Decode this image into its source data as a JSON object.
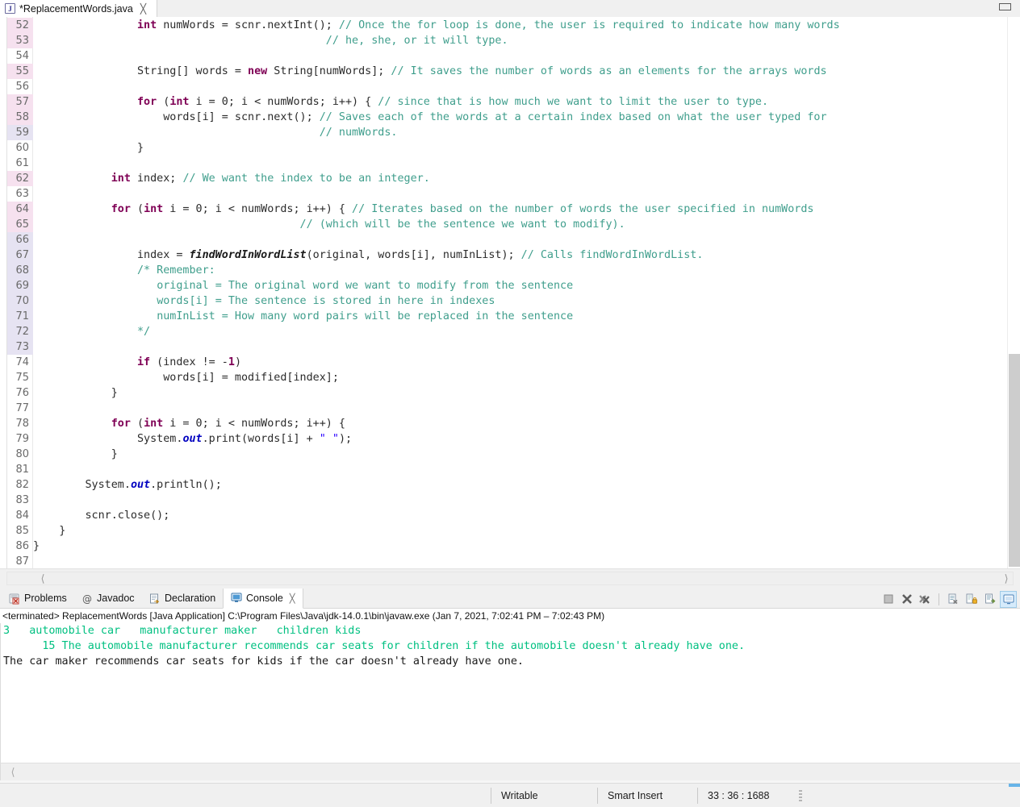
{
  "window": {
    "restore_button": "restore"
  },
  "editor_tab": {
    "filename": "*ReplacementWords.java",
    "icon": "java-file-icon",
    "close": "╳"
  },
  "editor": {
    "first_line": 52,
    "changed_lines_pink": [
      52,
      53,
      55,
      57,
      58,
      62,
      64,
      65
    ],
    "changed_lines_lavender": [
      59,
      66,
      67,
      68,
      69,
      70,
      71,
      72,
      73
    ],
    "lines": [
      {
        "n": 52,
        "indent": 0,
        "html": "                <kw>int</kw> numWords = scnr.nextInt(); <cm>// Once the for loop is done, the user is required to indicate how many words</cm>"
      },
      {
        "n": 53,
        "indent": 0,
        "html": "                                             <cm>// he, she, or it will type.</cm>"
      },
      {
        "n": 54,
        "indent": 0,
        "html": ""
      },
      {
        "n": 55,
        "indent": 0,
        "html": "                String[] words = <kw>new</kw> String[numWords]; <cm>// It saves the number of words as an elements for the arrays words</cm>"
      },
      {
        "n": 56,
        "indent": 0,
        "html": ""
      },
      {
        "n": 57,
        "indent": 0,
        "html": "                <kw>for</kw> (<kw>int</kw> i = 0; i &lt; numWords; i++) { <cm>// since that is how much we want to limit the user to type.</cm>"
      },
      {
        "n": 58,
        "indent": 0,
        "html": "                    words[i] = scnr.next(); <cm>// Saves each of the words at a certain index based on what the user typed for</cm>"
      },
      {
        "n": 59,
        "indent": 0,
        "html": "                                            <cm>// numWords.</cm>"
      },
      {
        "n": 60,
        "indent": 0,
        "html": "                }"
      },
      {
        "n": 61,
        "indent": 0,
        "html": ""
      },
      {
        "n": 62,
        "indent": 0,
        "html": "            <kw>int</kw> index; <cm>// We want the index to be an integer.</cm>"
      },
      {
        "n": 63,
        "indent": 0,
        "html": ""
      },
      {
        "n": 64,
        "indent": 0,
        "html": "            <kw>for</kw> (<kw>int</kw> i = 0; i &lt; numWords; i++) { <cm>// Iterates based on the number of words the user specified in numWords</cm>"
      },
      {
        "n": 65,
        "indent": 0,
        "html": "                                         <cm>// (which will be the sentence we want to modify).</cm>"
      },
      {
        "n": 66,
        "indent": 0,
        "html": ""
      },
      {
        "n": 67,
        "indent": 0,
        "html": "                index = <mth>findWordInWordList</mth>(original, words[i], numInList); <cm>// Calls findWordInWordList.</cm>"
      },
      {
        "n": 68,
        "indent": 0,
        "html": "                <cm>/* Remember:</cm>"
      },
      {
        "n": 69,
        "indent": 0,
        "html": "                   <cm>original = The original word we want to modify from the sentence</cm>"
      },
      {
        "n": 70,
        "indent": 0,
        "html": "                   <cm>words[i] = The sentence is stored in here in indexes</cm>"
      },
      {
        "n": 71,
        "indent": 0,
        "html": "                   <cm>numInList = How many word pairs will be replaced in the sentence</cm>"
      },
      {
        "n": 72,
        "indent": 0,
        "html": "                <cm>*/</cm>"
      },
      {
        "n": 73,
        "indent": 0,
        "html": ""
      },
      {
        "n": 74,
        "indent": 0,
        "html": "                <kw>if</kw> (index != -<kw>1</kw>)"
      },
      {
        "n": 75,
        "indent": 0,
        "html": "                    words[i] = modified[index];"
      },
      {
        "n": 76,
        "indent": 0,
        "html": "            }"
      },
      {
        "n": 77,
        "indent": 0,
        "html": ""
      },
      {
        "n": 78,
        "indent": 0,
        "html": "            <kw>for</kw> (<kw>int</kw> i = 0; i &lt; numWords; i++) {"
      },
      {
        "n": 79,
        "indent": 0,
        "html": "                System.<fld>out</fld>.print(words[i] + <str>\" \"</str>);"
      },
      {
        "n": 80,
        "indent": 0,
        "html": "            }"
      },
      {
        "n": 81,
        "indent": 0,
        "html": ""
      },
      {
        "n": 82,
        "indent": 0,
        "html": "        System.<fld>out</fld>.println();"
      },
      {
        "n": 83,
        "indent": 0,
        "html": ""
      },
      {
        "n": 84,
        "indent": 0,
        "html": "        scnr.close();"
      },
      {
        "n": 85,
        "indent": 0,
        "html": "    }"
      },
      {
        "n": 86,
        "indent": 0,
        "html": "}"
      },
      {
        "n": 87,
        "indent": 0,
        "html": ""
      }
    ]
  },
  "panel": {
    "tabs": [
      {
        "label": "Problems",
        "icon": "problems-icon",
        "active": false,
        "closable": false
      },
      {
        "label": "Javadoc",
        "icon": "javadoc-icon",
        "active": false,
        "closable": false
      },
      {
        "label": "Declaration",
        "icon": "declaration-icon",
        "active": false,
        "closable": false
      },
      {
        "label": "Console",
        "icon": "console-icon",
        "active": true,
        "closable": true
      }
    ],
    "close_glyph": "╳",
    "toolbar": [
      {
        "name": "terminate-button",
        "icon": "stop-square-icon"
      },
      {
        "name": "remove-launch-button",
        "icon": "x-icon"
      },
      {
        "name": "remove-all-terminated-button",
        "icon": "xx-icon"
      },
      {
        "name": "clear-console-button",
        "icon": "clear-page-icon"
      },
      {
        "name": "scroll-lock-button",
        "icon": "lock-icon"
      },
      {
        "name": "pin-console-button",
        "icon": "pin-page-icon"
      },
      {
        "name": "display-selected-console-button",
        "icon": "display-console-icon"
      }
    ],
    "launch_line": "<terminated> ReplacementWords [Java Application] C:\\Program Files\\Java\\jdk-14.0.1\\bin\\javaw.exe  (Jan 7, 2021, 7:02:41 PM – 7:02:43 PM)",
    "output": [
      {
        "kind": "input",
        "text": "3   automobile car   manufacturer maker   children kids"
      },
      {
        "kind": "input",
        "text": "      15 The automobile manufacturer recommends car seats for children if the automobile doesn't already have one."
      },
      {
        "kind": "output",
        "text": "The car maker recommends car seats for kids if the car doesn't already have one."
      }
    ]
  },
  "statusbar": {
    "writable": "Writable",
    "insert_mode": "Smart Insert",
    "position": "33 : 36 : 1688"
  },
  "colors": {
    "keyword": "#7f0055",
    "comment": "#3f9e8c",
    "string": "#2a00ff",
    "field": "#0000c0",
    "console_input": "#00c081",
    "console_output": "#1a1a1a",
    "changed_pink": "#f6e1ef",
    "changed_lavender": "#e6e3f2",
    "tab_selected": "#d6ebfb"
  }
}
